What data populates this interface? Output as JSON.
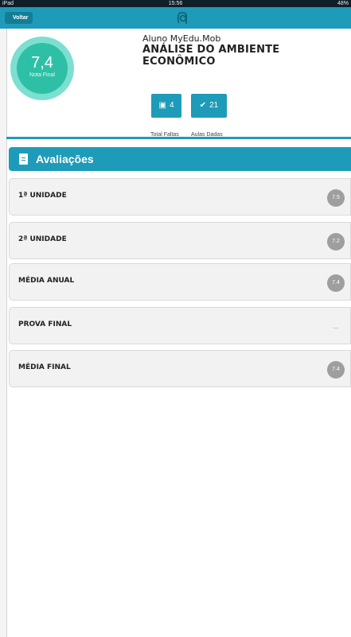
{
  "status_bar": {
    "carrier": "iPad",
    "time": "15:56",
    "battery": "48%"
  },
  "nav": {
    "back_label": "Voltar",
    "logo_icon": "myedu-logo-icon"
  },
  "summary": {
    "final_grade": "7,4",
    "final_grade_label": "Nota Final",
    "student_name": "Aluno MyEdu.Mob",
    "course_title": "ANÁLISE DO AMBIENTE ECONÔMICO",
    "absences_value": "4",
    "absences_label": "Total Faltas",
    "classes_value": "21",
    "classes_label": "Aulas Dadas"
  },
  "section": {
    "title": "Avaliações"
  },
  "rows": [
    {
      "label": "1ª UNIDADE",
      "value": "7.5"
    },
    {
      "label": "2ª UNIDADE",
      "value": "7.2"
    },
    {
      "label": "MÉDIA ANUAL",
      "value": "7.4"
    },
    {
      "label": "PROVA FINAL",
      "value": "..."
    },
    {
      "label": "MÉDIA FINAL",
      "value": "7.4"
    }
  ],
  "colors": {
    "accent": "#1e9bb8",
    "grade_circle": "#2ec0a6",
    "badge": "#9e9e9e"
  }
}
